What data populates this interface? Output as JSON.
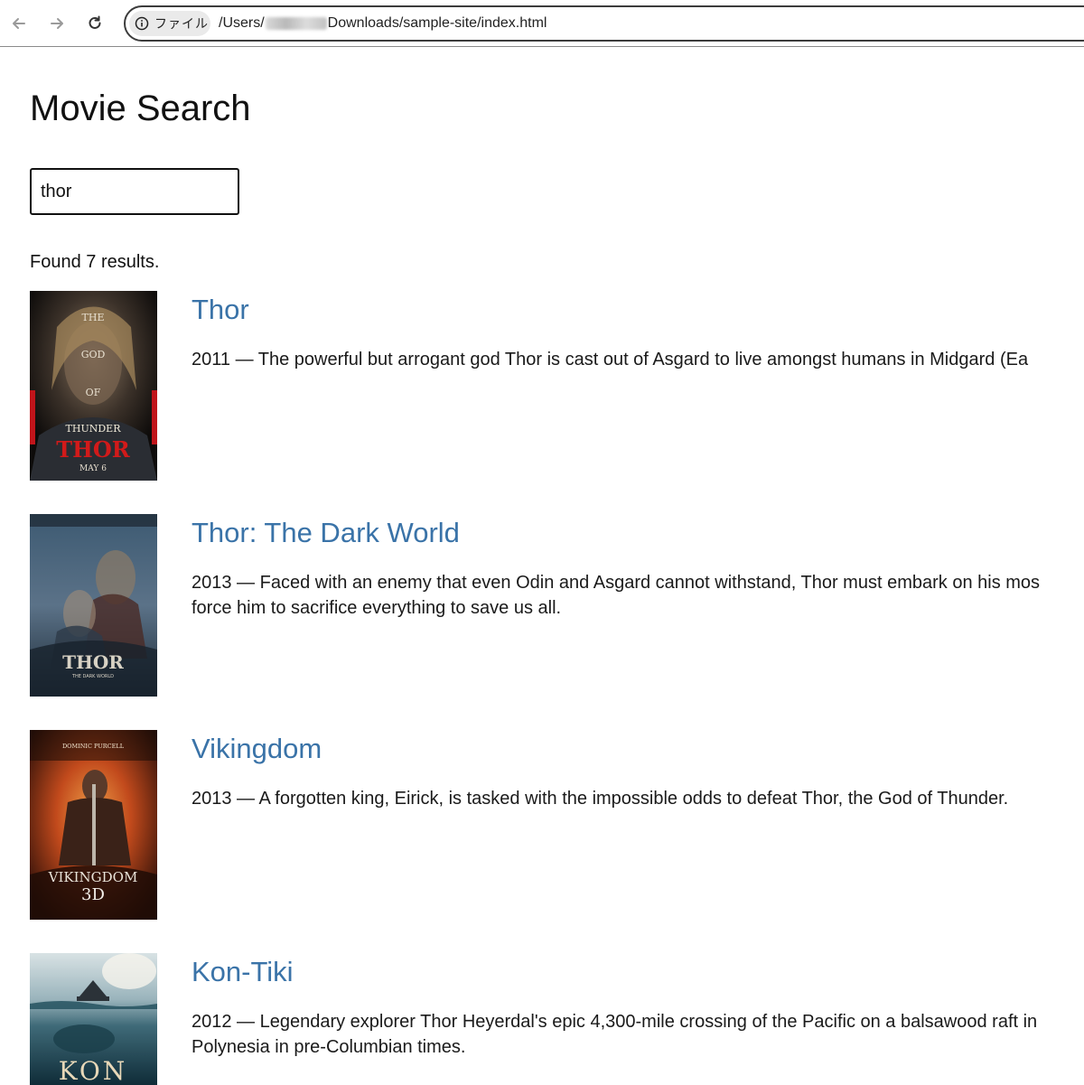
{
  "browser": {
    "chip_label": "ファイル",
    "url_prefix": "/Users/",
    "url_suffix": "Downloads/sample-site/index.html"
  },
  "page": {
    "title": "Movie Search",
    "search_value": "thor",
    "results_count": "Found 7 results."
  },
  "results": [
    {
      "title": "Thor",
      "desc_line1": "2011 — The powerful but arrogant god Thor is cast out of Asgard to live amongst humans in Midgard (Ea",
      "desc_line2": "",
      "poster": {
        "l1": "THE",
        "l2": "GOD",
        "l3": "OF",
        "l4": "THUNDER",
        "main": "THOR",
        "date": "MAY 6"
      }
    },
    {
      "title": "Thor: The Dark World",
      "desc_line1": "2013 — Faced with an enemy that even Odin and Asgard cannot withstand, Thor must embark on his mos",
      "desc_line2": "force him to sacrifice everything to save us all.",
      "poster": {
        "main": "THOR",
        "sub": "THE DARK WORLD"
      }
    },
    {
      "title": "Vikingdom",
      "desc_line1": "2013 — A forgotten king, Eirick, is tasked with the impossible odds to defeat Thor, the God of Thunder.",
      "desc_line2": "",
      "poster": {
        "top": "DOMINIC PURCELL",
        "main": "VIKINGDOM",
        "sub": "3D"
      }
    },
    {
      "title": "Kon-Tiki",
      "desc_line1": "2012 — Legendary explorer Thor Heyerdal's epic 4,300-mile crossing of the Pacific on a balsawood raft in",
      "desc_line2": "Polynesia in pre-Columbian times.",
      "poster": {
        "main": "KON"
      }
    }
  ]
}
